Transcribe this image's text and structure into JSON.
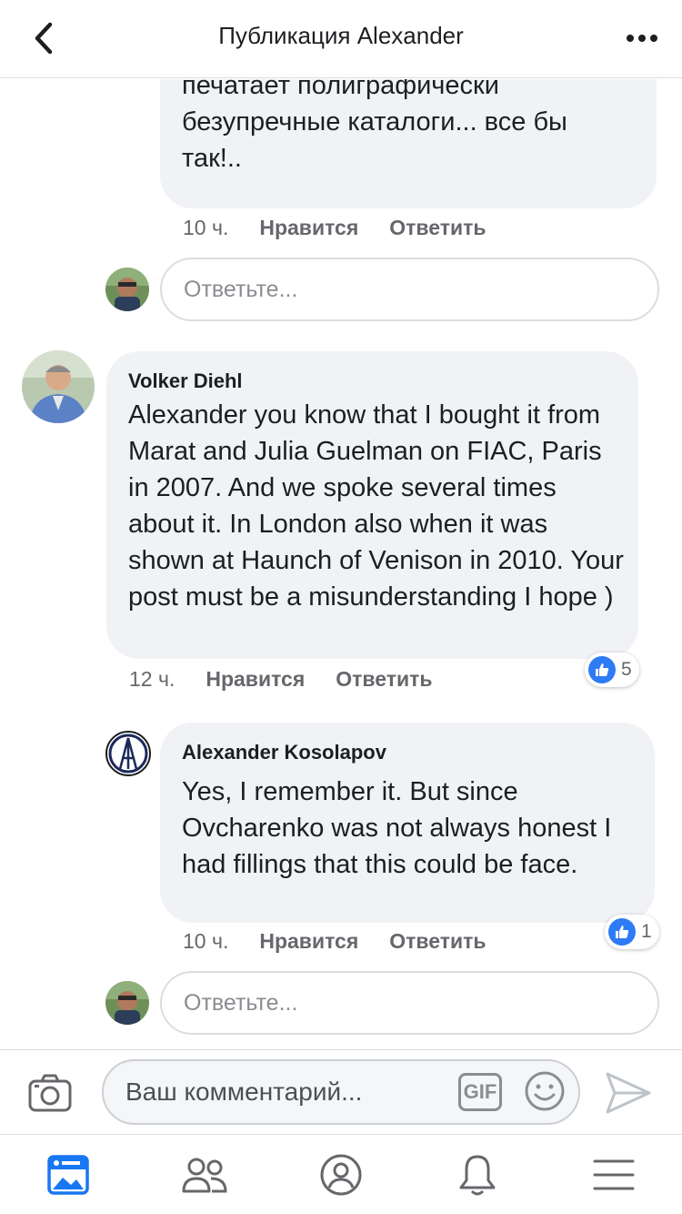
{
  "header": {
    "title": "Публикация Alexander"
  },
  "comments": [
    {
      "text_partial": "текстов о продаваемых работах,\nпечатает полиграфически\nбезупречные каталоги... все бы\nтак!..",
      "time": "10 ч.",
      "like": "Нравится",
      "reply": "Ответить"
    },
    {
      "author": "Volker Diehl",
      "text": "Alexander you know that I bought it from Marat and Julia Guelman on FIAC, Paris  in 2007. And we spoke several times about it. In London also when it was shown at Haunch of Venison in 2010. Your post must be a misunderstanding I hope )",
      "time": "12 ч.",
      "like": "Нравится",
      "reply": "Ответить",
      "reactions": "5"
    },
    {
      "author": "Alexander Kosolapov",
      "text": "Yes, I remember it. But since Ovcharenko was not always honest I had fillings that this could be face.",
      "time": "10 ч.",
      "like": "Нравится",
      "reply": "Ответить",
      "reactions": "1"
    }
  ],
  "reply_placeholder": "Ответьте...",
  "composer": {
    "placeholder": "Ваш комментарий...",
    "gif": "GIF"
  },
  "icons": {
    "back": "chevron-left-icon",
    "more": "more-dots-icon",
    "camera": "camera-icon",
    "smile": "smile-icon",
    "send": "send-icon",
    "nav": [
      "news-feed-icon",
      "friends-icon",
      "profile-icon",
      "notifications-icon",
      "menu-icon"
    ]
  },
  "colors": {
    "accent": "#1877f2",
    "bubble": "#f0f2f5",
    "like": "#2e7bf6"
  }
}
